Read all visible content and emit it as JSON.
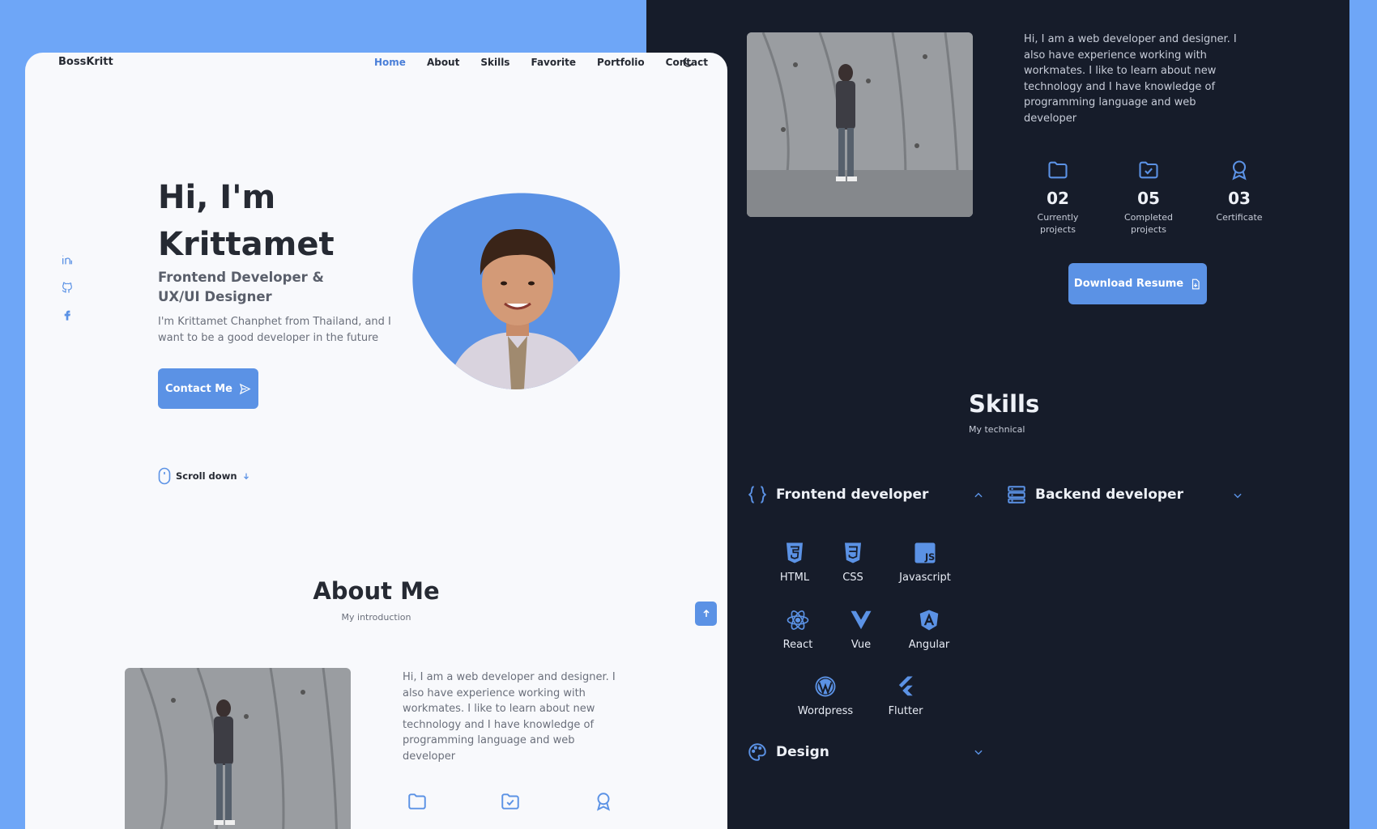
{
  "light": {
    "brand": "BossKritt",
    "nav": [
      "Home",
      "About",
      "Skills",
      "Favorite",
      "Portfolio",
      "Contact"
    ],
    "hero": {
      "title_line1": "Hi, I'm",
      "title_line2": "Krittamet",
      "subtitle": "Frontend Developer & UX/UI Designer",
      "description": "I'm Krittamet Chanphet from Thailand, and I want to be a good developer in the future",
      "contact_button": "Contact Me",
      "scroll_label": "Scroll down"
    },
    "about": {
      "title": "About Me",
      "subtitle": "My introduction",
      "text": "Hi, I am a web developer and designer. I also have experience working with workmates. I like to learn about new technology and I have knowledge of programming language and web developer"
    }
  },
  "dark": {
    "about_text": "Hi, I am a web developer and designer. I also have experience working with workmates. I like to learn about new technology and I have knowledge of programming language and web developer",
    "stats": [
      {
        "number": "02",
        "label": "Currently projects",
        "icon": "folder-icon"
      },
      {
        "number": "05",
        "label": "Completed projects",
        "icon": "folder-check-icon"
      },
      {
        "number": "03",
        "label": "Certificate",
        "icon": "award-icon"
      }
    ],
    "resume_button": "Download Resume",
    "skills": {
      "title": "Skills",
      "subtitle": "My technical",
      "frontend_label": "Frontend developer",
      "backend_label": "Backend developer",
      "design_label": "Design",
      "frontend_items": [
        "HTML",
        "CSS",
        "Javascript",
        "React",
        "Vue",
        "Angular",
        "Wordpress",
        "Flutter"
      ]
    }
  },
  "colors": {
    "accent": "#5b92e5",
    "dark_bg": "#161c2a",
    "light_bg": "#f8f9fc",
    "page_bg": "#6ea6f7"
  }
}
